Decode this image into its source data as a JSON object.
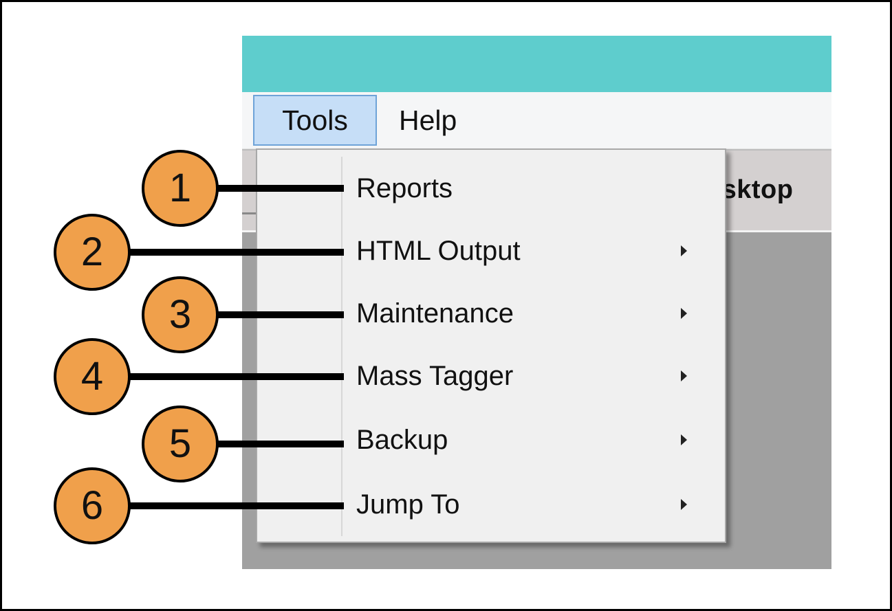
{
  "menubar": {
    "tools_label": "Tools",
    "help_label": "Help"
  },
  "toolbar": {
    "tab_label_fragment": "esktop"
  },
  "tools_menu": {
    "items": [
      {
        "label": "Reports",
        "has_submenu": false
      },
      {
        "label": "HTML Output",
        "has_submenu": true
      },
      {
        "label": "Maintenance",
        "has_submenu": true
      },
      {
        "label": "Mass Tagger",
        "has_submenu": true
      },
      {
        "label": "Backup",
        "has_submenu": true
      },
      {
        "label": "Jump To",
        "has_submenu": true
      }
    ]
  },
  "callouts": [
    "1",
    "2",
    "3",
    "4",
    "5",
    "6"
  ],
  "colors": {
    "titlebar": "#5ecdcd",
    "menu_highlight": "#c6def7",
    "callout_fill": "#f0a04b"
  }
}
